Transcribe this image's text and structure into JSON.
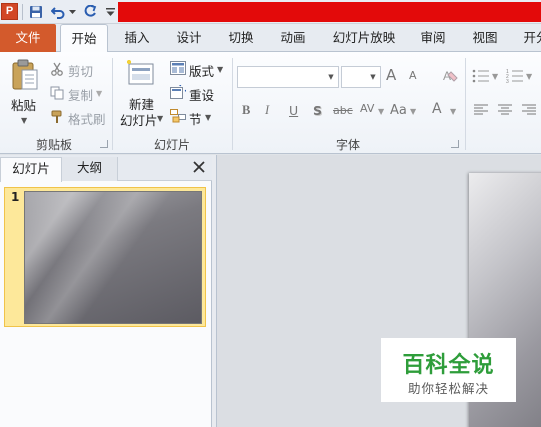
{
  "quick_access": {
    "app_icon_letter": "P",
    "title_bar_color": "#e30a0a"
  },
  "tabs": [
    {
      "label": "文件",
      "active": false
    },
    {
      "label": "开始",
      "active": true
    },
    {
      "label": "插入"
    },
    {
      "label": "设计"
    },
    {
      "label": "切换"
    },
    {
      "label": "动画"
    },
    {
      "label": "幻灯片放映"
    },
    {
      "label": "审阅"
    },
    {
      "label": "视图"
    },
    {
      "label": "开分"
    }
  ],
  "ribbon": {
    "clipboard": {
      "paste": "粘贴",
      "cut": "剪切",
      "copy": "复制",
      "format_painter": "格式刷",
      "group_label": "剪贴板"
    },
    "slides": {
      "new_slide_line1": "新建",
      "new_slide_line2": "幻灯片",
      "layout": "版式",
      "reset": "重设",
      "section": "节",
      "group_label": "幻灯片"
    },
    "font": {
      "group_label": "字体",
      "bold": "B",
      "italic": "I",
      "underline": "U",
      "shadow": "S",
      "strike": "abc",
      "spacing": "AV",
      "case": "Aa",
      "color": "A",
      "grow": "A",
      "shrink": "A"
    }
  },
  "left_panel": {
    "tab_slides": "幻灯片",
    "tab_outline": "大纲",
    "slide_number": "1"
  },
  "watermark": {
    "title": "百科全说",
    "subtitle": "助你轻松解决"
  },
  "colors": {
    "file_tab": "#d35a2c",
    "selection": "#fde89a",
    "watermark_green": "#2e9d3a"
  }
}
